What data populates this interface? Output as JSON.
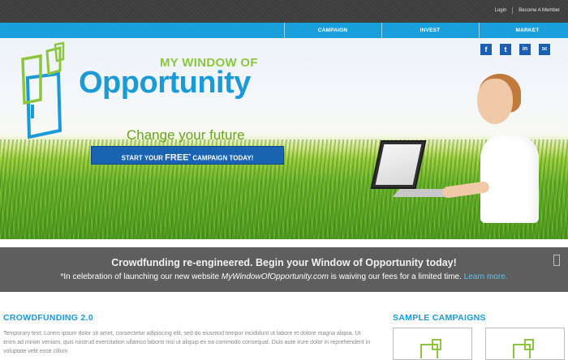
{
  "top_links": {
    "login": "Login",
    "become_member": "Become A Member"
  },
  "nav": {
    "items": [
      "CAMPAIGN",
      "INVEST",
      "MARKET"
    ]
  },
  "social": {
    "facebook": "f",
    "twitter": "t",
    "linkedin": "in",
    "email": "✉"
  },
  "hero": {
    "logo_top": "MY WINDOW OF",
    "logo_main": "Opportunity",
    "tagline_a": "Change",
    "tagline_b": "your future",
    "cta_a": "START YOUR",
    "cta_free": "FREE",
    "cta_star": "*",
    "cta_b": "CAMPAIGN TODAY!"
  },
  "banner": {
    "line1": "Crowdfunding re-engineered.   Begin your Window of Opportunity today!",
    "line2_a": "*In celebration of launching our new website",
    "line2_site": "MyWindowOfOpportunity.com",
    "line2_b": "is waiving our fees for a limited time.",
    "learn_more": "Learn more."
  },
  "content": {
    "left_title": "CROWDFUNDING 2.0",
    "body": "Temporary text: Lorem ipsum dolor sit amet, consectetur adipiscing elit, sed do eiusmod tempor incididunt ut labore et dolore magna aliqua. Ut enim ad minim veniam, quis nostrud exercitation ullamco laboris nisi ut aliquip ex ea commodo consequat. Duis aute irure dolor in reprehenderit in voluptate velit esse cillum",
    "right_title": "SAMPLE CAMPAIGNS"
  },
  "colors": {
    "brand_blue": "#1a9ad7",
    "brand_green": "#8cc63e",
    "nav_blue": "#19a0dc",
    "cta_blue": "#1a63b1",
    "banner_gray": "#5e5e5e"
  }
}
